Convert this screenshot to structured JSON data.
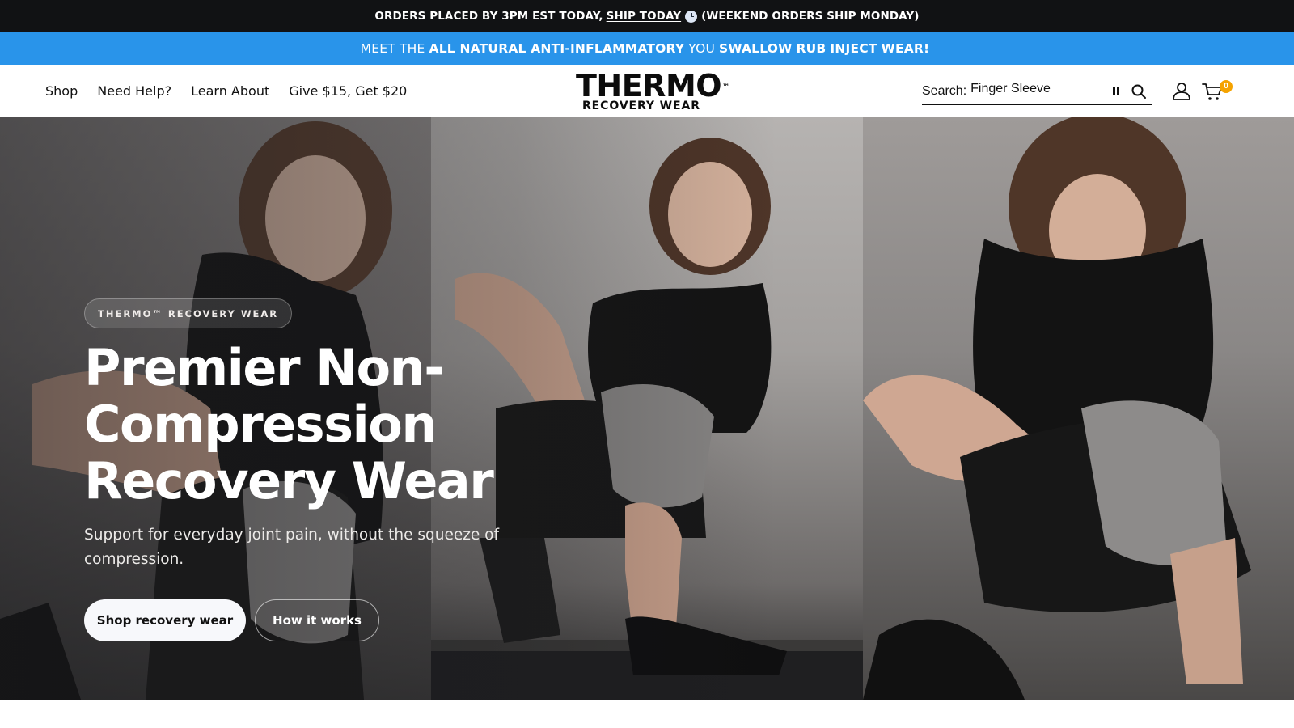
{
  "announcement": {
    "text": "ORDERS PLACED BY 3PM EST TODAY,",
    "link": "SHIP TODAY",
    "icon": "clock-icon",
    "suffix": "(WEEKEND ORDERS SHIP MONDAY)"
  },
  "promo": {
    "prefix": "MEET THE",
    "bold": "ALL NATURAL ANTI-INFLAMMATORY",
    "mid": "YOU",
    "struck": [
      "SWALLOW",
      "RUB",
      "INJECT"
    ],
    "end": "WEAR!"
  },
  "nav": [
    "Shop",
    "Need Help?",
    "Learn About",
    "Give $15, Get $20"
  ],
  "logo": {
    "line1": "THERMO",
    "tm": "™",
    "line2": "RECOVERY WEAR"
  },
  "search": {
    "label": "Search:",
    "value": "Finger Sleeve"
  },
  "cart": {
    "count": "0"
  },
  "hero": {
    "eyebrow": "THERMO™ RECOVERY WEAR",
    "title": "Premier Non-Compression Recovery Wear",
    "subtitle": "Support for everyday joint pain, without the squeeze of compression.",
    "primary_cta": "Shop recovery wear",
    "secondary_cta": "How it works"
  },
  "colors": {
    "announcement_bg": "#111214",
    "promo_bg": "#2994ea",
    "cart_badge": "#f5a300"
  }
}
